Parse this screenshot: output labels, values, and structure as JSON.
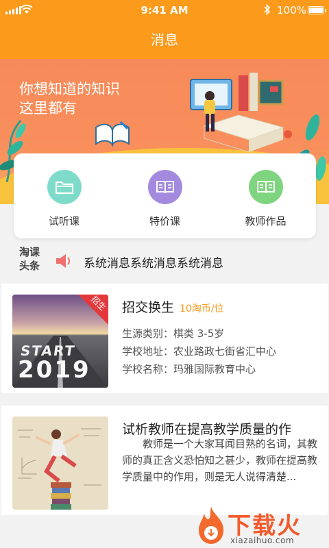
{
  "status_bar": {
    "time": "9:41 AM",
    "battery_text": "100%",
    "battery_level": 1.0,
    "icons": [
      "signal-icon",
      "wifi-icon",
      "bluetooth-icon",
      "battery-icon"
    ]
  },
  "header": {
    "title": "消息"
  },
  "banner": {
    "slogan_line1": "你想知道的知识",
    "slogan_line2": "这里都有"
  },
  "quick_nav": [
    {
      "label": "试听课",
      "icon": "folder-icon",
      "color": "#7edbc9"
    },
    {
      "label": "特价课",
      "icon": "book-icon",
      "color": "#a48adf"
    },
    {
      "label": "教师作品",
      "icon": "book-icon",
      "color": "#7fd47f"
    }
  ],
  "headlines": {
    "brand_line1": "淘课",
    "brand_line2": "头条",
    "message": "系统消息系统消息系统消息",
    "icon": "speaker-icon"
  },
  "cards": [
    {
      "title": "招交换生",
      "price": "10淘币/位",
      "badge": "招生",
      "thumb_text": {
        "line1": "START",
        "line2": "2019"
      },
      "info": [
        "生源类别：棋类 3-5岁",
        "学校地址：农业路政七街省汇中心",
        "学校名称：玛雅国际教育中心"
      ]
    },
    {
      "title": "试析教师在提高教学质量的作",
      "excerpt": "教师是一个大家耳闻目熟的名词，其教师的真正含义恐怕知之甚少，教师在提高教学质量中的作用，则是无人说得清楚..."
    }
  ],
  "watermark": {
    "text": "下载火",
    "url": "xiazaihuo.com"
  },
  "colors": {
    "primary": "#fb9a1b",
    "badge": "#e4393c"
  }
}
